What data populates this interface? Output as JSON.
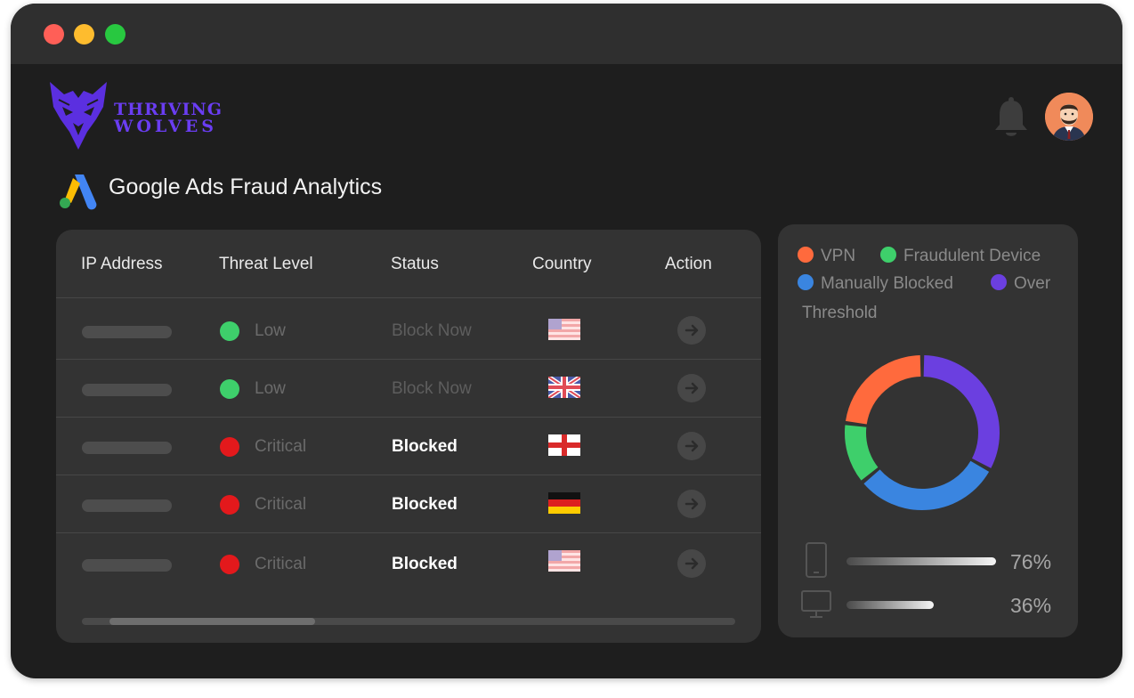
{
  "window": {
    "controls": [
      "close",
      "minimize",
      "maximize"
    ]
  },
  "brand": {
    "line1": "THRIVING",
    "line2": "WOLVES",
    "color": "#6a3df2"
  },
  "header": {
    "notification_icon": "bell-icon",
    "avatar_icon": "user-avatar"
  },
  "page": {
    "title": "Google Ads Fraud Analytics",
    "icon": "google-ads-icon"
  },
  "table": {
    "columns": [
      "IP Address",
      "Threat Level",
      "Status",
      "Country",
      "Action"
    ],
    "rows": [
      {
        "threat": "Low",
        "threat_color": "#3ecf6b",
        "status": "Block Now",
        "status_style": "muted",
        "country": "us-flag"
      },
      {
        "threat": "Low",
        "threat_color": "#3ecf6b",
        "status": "Block Now",
        "status_style": "muted",
        "country": "uk-flag"
      },
      {
        "threat": "Critical",
        "threat_color": "#e3191c",
        "status": "Blocked",
        "status_style": "bold",
        "country": "england-flag"
      },
      {
        "threat": "Critical",
        "threat_color": "#e3191c",
        "status": "Blocked",
        "status_style": "bold",
        "country": "germany-flag"
      },
      {
        "threat": "Critical",
        "threat_color": "#e3191c",
        "status": "Blocked",
        "status_style": "bold",
        "country": "us-flag"
      }
    ],
    "scroll_position": 0.04,
    "scroll_visible_fraction": 0.31
  },
  "legend": [
    {
      "label": "VPN",
      "color": "#ff6a3d"
    },
    {
      "label": "Fraudulent Device",
      "color": "#3ecf6b"
    },
    {
      "label": "Manually Blocked",
      "color": "#3a85e0"
    },
    {
      "label": "Over",
      "color": "#6b3fe0"
    }
  ],
  "legend_continuation": "Threshold",
  "chart_data": {
    "type": "pie",
    "style": "donut",
    "categories": [
      "Over Threshold",
      "Manually Blocked",
      "Fraudulent Device",
      "VPN"
    ],
    "values": [
      33,
      31,
      13,
      23
    ],
    "colors": [
      "#6b3fe0",
      "#3a85e0",
      "#3ecf6b",
      "#ff6a3d"
    ]
  },
  "metrics": [
    {
      "icon": "mobile-icon",
      "value": 76,
      "label": "76%"
    },
    {
      "icon": "desktop-icon",
      "value": 36,
      "label": "36%"
    }
  ]
}
